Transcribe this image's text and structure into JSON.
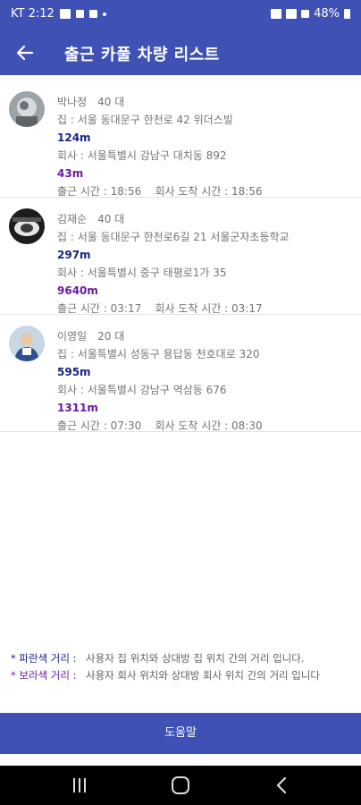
{
  "status_bar": {
    "carrier_time": "KT 2:12",
    "battery": "48%"
  },
  "app_bar": {
    "title": "출근 카풀 차량 리스트",
    "back_icon": "arrow-left-icon"
  },
  "carpool_list": [
    {
      "name": "박나정",
      "age": "40 대",
      "home": "집 : 서울 동대문구 한천로 42 위더스빌",
      "home_distance": "124m",
      "office": "회사 : 서울특별시 강남구 대치동 892",
      "office_distance": "43m",
      "times": "출근 시간 : 18:56    회사 도착 시간 : 18:56"
    },
    {
      "name": "김재순",
      "age": "40 대",
      "home": "집 : 서울 동대문구 한천로6길 21 서울군자초등학교",
      "home_distance": "297m",
      "office": "회사 : 서울특별시 중구 태평로1가 35",
      "office_distance": "9640m",
      "times": "출근 시간 : 03:17    회사 도착 시간 : 03:17"
    },
    {
      "name": "이영일",
      "age": "20 대",
      "home": "집 : 서울특별시 성동구 용답동 천호대로 320",
      "home_distance": "595m",
      "office": "회사 : 서울특별시 강남구 역삼동 676",
      "office_distance": "1311m",
      "times": "출근 시간 : 07:30    회사 도착 시간 : 08:30"
    }
  ],
  "legend": {
    "blue_key": "* 파란색 거리 :",
    "blue_desc": "사용자 집 위치와 상대방 집 위치 간의 거리 입니다.",
    "purple_key": "* 보라색 거리 :",
    "purple_desc": "사용자 회사 위치와 상대방 회사 위치 간의 거리 입니다"
  },
  "help_button": "도움말",
  "colors": {
    "primary": "#3f51b5",
    "blue_distance": "#1a237e",
    "purple_distance": "#6a1b9a"
  }
}
